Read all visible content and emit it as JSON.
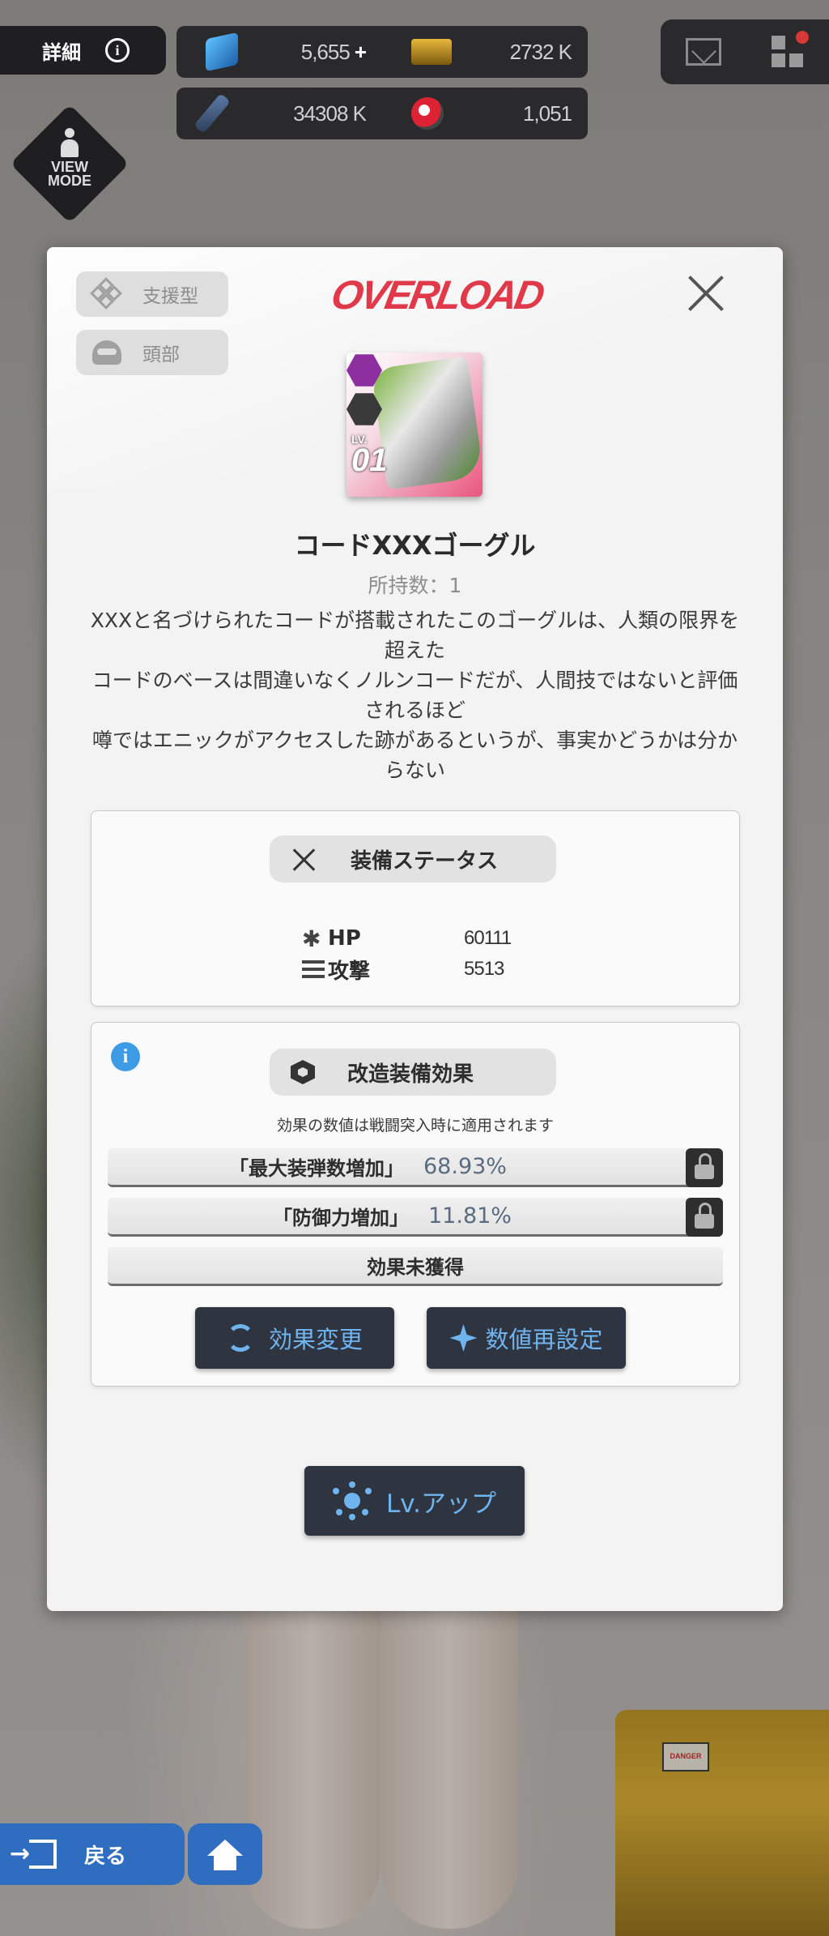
{
  "hud": {
    "detail_label": "詳細",
    "info_glyph": "i",
    "currencies": [
      {
        "icon": "gem-icon",
        "value": "5,655",
        "plus": "+"
      },
      {
        "icon": "credit-card-icon",
        "value": "2732 K"
      },
      {
        "icon": "battle-data-icon",
        "value": "34308 K"
      },
      {
        "icon": "core-dust-icon",
        "value": "1,051"
      }
    ],
    "view_mode_label": "VIEW\nMODE"
  },
  "modal": {
    "title_logo": "OVERLOAD",
    "tags": [
      {
        "icon": "support-class-icon",
        "label": "支援型"
      },
      {
        "icon": "head-slot-icon",
        "label": "頭部"
      }
    ],
    "item": {
      "level_label": "LV.",
      "level": "01",
      "name": "コードXXXゴーグル",
      "owned": "所持数：1",
      "description": [
        "XXXと名づけられたコードが搭載されたこのゴーグルは、人類の限界を超えた",
        "コードのベースは間違いなくノルンコードだが、人間技ではないと評価されるほど",
        "噂ではエニックがアクセスした跡があるというが、事実かどうかは分からない"
      ]
    },
    "status_panel": {
      "title": "装備ステータス",
      "stats": [
        {
          "icon": "hp-icon",
          "glyph": "✱",
          "label": "HP",
          "value": "60111"
        },
        {
          "icon": "attack-icon",
          "label": "攻撃",
          "value": "5513"
        }
      ]
    },
    "effects_panel": {
      "info_glyph": "i",
      "title": "改造装備効果",
      "note": "効果の数値は戦闘突入時に適用されます",
      "effects": [
        {
          "name": "「最大装弾数増加」",
          "value": "68.93%",
          "locked": true
        },
        {
          "name": "「防御力増加」",
          "value": "11.81%",
          "locked": true
        },
        {
          "name": "効果未獲得",
          "value": ""
        }
      ],
      "change_button": "効果変更",
      "reset_button": "数値再設定"
    },
    "lvup_button": "Lv.アップ"
  },
  "bottom_nav": {
    "back_label": "戻る"
  },
  "colors": {
    "accent_blue": "#6fb4ee",
    "overload_red": "#e0394a",
    "dark_button": "#2f3441",
    "nav_blue": "#2e6dbf"
  }
}
